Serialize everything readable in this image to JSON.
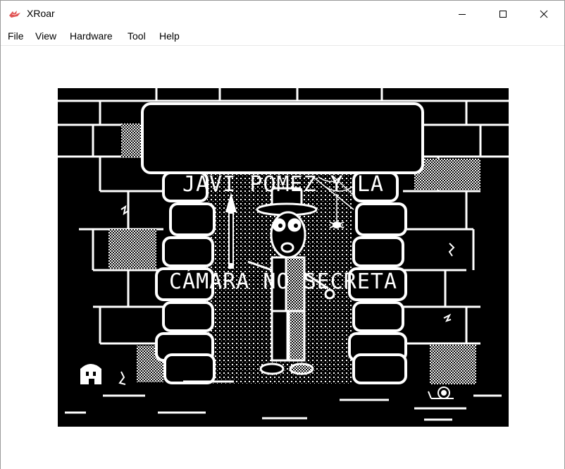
{
  "window": {
    "title": "XRoar",
    "icon": "xroar-dragon-icon",
    "controls": [
      "minimize-icon",
      "maximize-icon",
      "close-icon"
    ]
  },
  "menu": {
    "items": [
      {
        "label": "File"
      },
      {
        "label": "View"
      },
      {
        "label": "Hardware"
      },
      {
        "label": "Tool"
      },
      {
        "label": "Help"
      }
    ]
  },
  "game": {
    "title_line1": "JAVI PÓMEZ Y LA",
    "title_line2": "CÁMARA NO SECRETA"
  },
  "colors": {
    "screen_bg": "#000000",
    "screen_fg": "#ffffff"
  }
}
